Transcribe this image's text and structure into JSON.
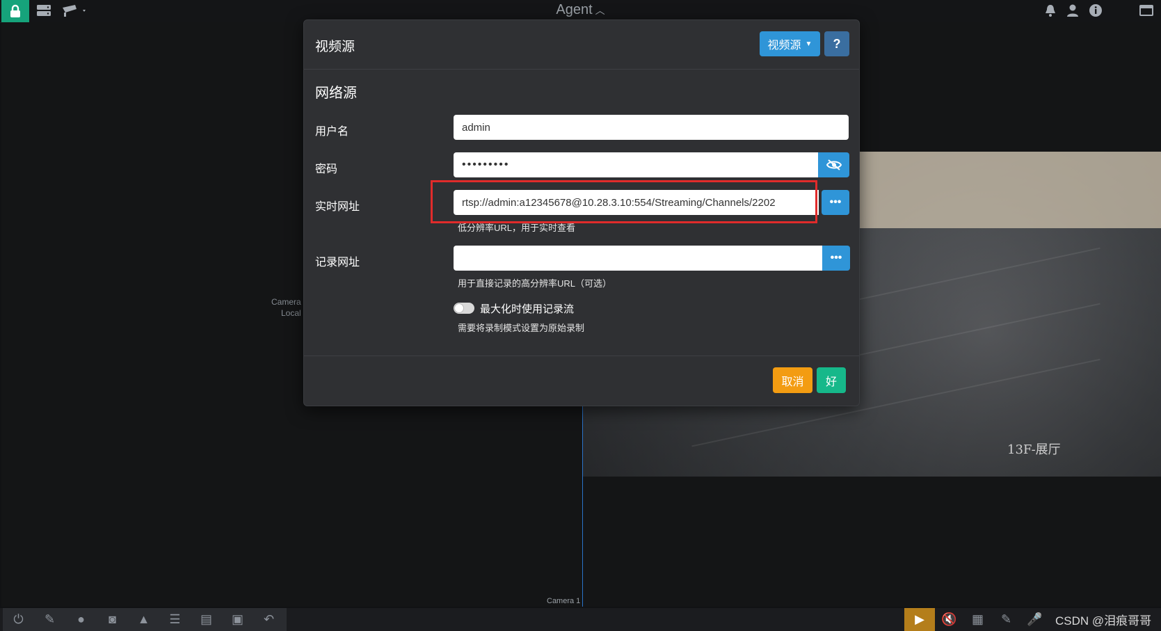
{
  "app": {
    "title": "Agent"
  },
  "topbar": {
    "icons": [
      "lock-icon",
      "server-icon",
      "camera-icon",
      "bell-icon",
      "user-icon",
      "info-icon",
      "window-icon"
    ]
  },
  "modal": {
    "title": "视频源",
    "source_button_label": "视频源",
    "help_button_label": "?",
    "section_title": "网络源",
    "username": {
      "label": "用户名",
      "value": "admin"
    },
    "password": {
      "label": "密码",
      "value": "•••••••••"
    },
    "live_url": {
      "label": "实时网址",
      "value": "rtsp://admin:a12345678@10.28.3.10:554/Streaming/Channels/2202",
      "hint": "低分辨率URL，用于实时查看",
      "more_button_label": "•••"
    },
    "record_url": {
      "label": "记录网址",
      "value": "",
      "hint": "用于直接记录的高分辨率URL（可选）",
      "more_button_label": "•••"
    },
    "max_record_toggle": {
      "label": "最大化时使用记录流",
      "checked": false,
      "hint": "需要将录制模式设置为原始录制"
    },
    "cancel_label": "取消",
    "ok_label": "好"
  },
  "background": {
    "camera_left_line1": "Camera",
    "camera_left_line2": "Local",
    "camera_1_label": "Camera 1",
    "camera_feed_label": "13F-展厅"
  },
  "watermark": "CSDN @泪痕哥哥",
  "colors": {
    "accent_blue": "#2f95d8",
    "accent_green": "#16b88a",
    "cancel_orange": "#f39c12",
    "highlight_red": "#e02b2b"
  }
}
